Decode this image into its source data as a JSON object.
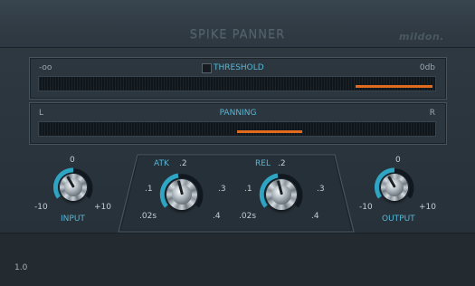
{
  "header": {
    "title": "SPIKE PANNER",
    "brand": "mildon."
  },
  "threshold": {
    "label": "THRESHOLD",
    "min_label": "-oo",
    "max_label": "0db",
    "level_fraction_start": 0.8,
    "level_fraction_end": 0.995
  },
  "panning": {
    "label": "PANNING",
    "left_label": "L",
    "right_label": "R",
    "bar_start": 0.5,
    "bar_end": 0.665
  },
  "input_knob": {
    "label": "INPUT",
    "min": "-10",
    "mid": "0",
    "max": "+10"
  },
  "attack_knob": {
    "label": "ATK",
    "t1": ".1",
    "t2": ".2",
    "t3": ".3",
    "t4": ".4",
    "t0": ".02s"
  },
  "release_knob": {
    "label": "REL",
    "t1": ".1",
    "t2": ".2",
    "t3": ".3",
    "t4": ".4",
    "t0": ".02s"
  },
  "output_knob": {
    "label": "OUTPUT",
    "min": "-10",
    "mid": "0",
    "max": "+10"
  },
  "footer": {
    "version": "1.0"
  },
  "colors": {
    "accent": "#57b7d6",
    "meter_bar": "#e06a1e",
    "background": "#2a343c"
  }
}
